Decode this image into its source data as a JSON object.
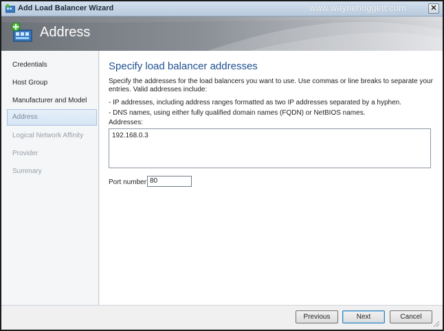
{
  "window": {
    "title": "Add Load Balancer Wizard",
    "watermark": "www.waynehoggett.com",
    "close_glyph": "✕"
  },
  "header": {
    "title": "Address",
    "icon": "load-balancer-icon"
  },
  "nav": {
    "items": [
      {
        "label": "Credentials",
        "state": "normal"
      },
      {
        "label": "Host Group",
        "state": "normal"
      },
      {
        "label": "Manufacturer and Model",
        "state": "normal"
      },
      {
        "label": "Address",
        "state": "active"
      },
      {
        "label": "Logical Network Affinity",
        "state": "disabled"
      },
      {
        "label": "Provider",
        "state": "disabled"
      },
      {
        "label": "Summary",
        "state": "disabled"
      }
    ]
  },
  "main": {
    "heading": "Specify load balancer addresses",
    "description": "Specify the addresses for the load balancers you want to use. Use commas or line breaks to separate your entries. Valid addresses include:",
    "bullets": [
      "- IP addresses, including address ranges formatted as two IP addresses separated by a hyphen.",
      "- DNS names, using either fully qualified domain names (FQDN) or NetBIOS names."
    ],
    "addresses_label": "Addresses:",
    "addresses_value": "192.168.0.3",
    "port_label": "Port number:",
    "port_value": "80"
  },
  "footer": {
    "previous_label": "Previous",
    "next_label": "Next",
    "cancel_label": "Cancel"
  },
  "colors": {
    "heading": "#1f4f8f",
    "active_nav_bg": "#d6e5f5",
    "header_bg": "#8a8f96"
  }
}
